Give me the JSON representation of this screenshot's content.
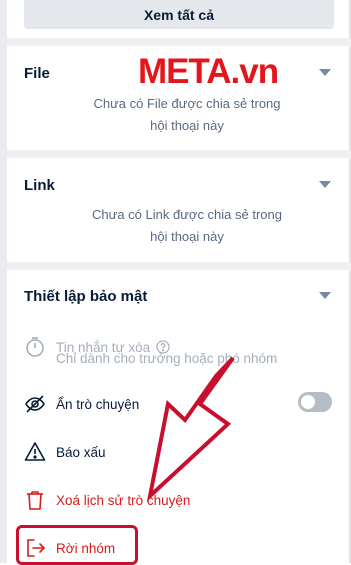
{
  "top": {
    "view_all_label": "Xem tất cả"
  },
  "watermark": "META.vn",
  "sections": {
    "file": {
      "title": "File",
      "empty_line1": "Chưa có File được chia sẻ trong",
      "empty_line2": "hội thoại này"
    },
    "link": {
      "title": "Link",
      "empty_line1": "Chưa có Link được chia sẻ trong",
      "empty_line2": "hội thoại này"
    },
    "security": {
      "title": "Thiết lập bảo mật",
      "auto_delete_label": "Tin nhắn tự xóa",
      "auto_delete_sub": "Chỉ dành cho trưởng hoặc phó nhóm",
      "hide_chat_label": "Ẩn trò chuyện",
      "hide_chat_on": false,
      "report_label": "Báo xấu",
      "clear_history_label": "Xoá lịch sử trò chuyện",
      "leave_group_label": "Rời nhóm"
    }
  },
  "colors": {
    "danger": "#d91b1b",
    "annotation": "#c8102e",
    "watermark": "#e3161c"
  },
  "icons": [
    "timer-icon",
    "help-circle-icon",
    "eye-off-icon",
    "warning-icon",
    "trash-icon",
    "leave-icon",
    "chevron-down-icon"
  ]
}
